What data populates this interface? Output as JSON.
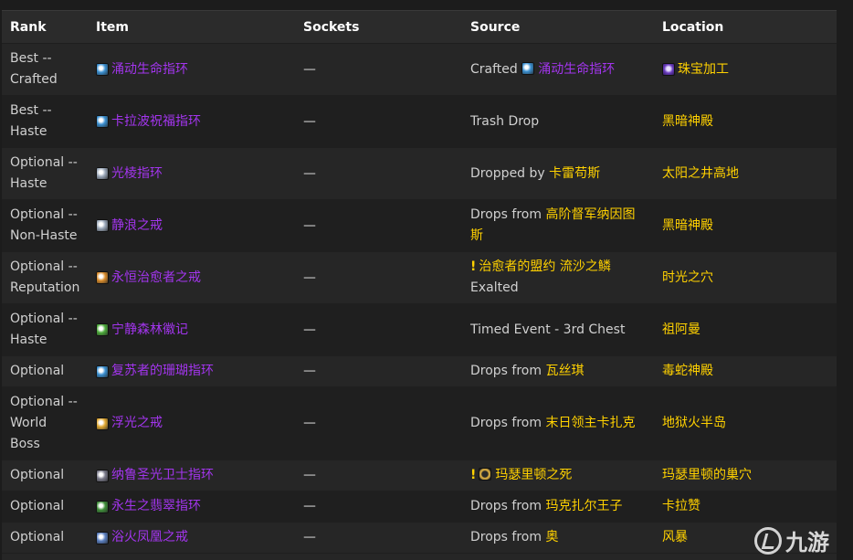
{
  "headers": {
    "rank": "Rank",
    "item": "Item",
    "sockets": "Sockets",
    "source": "Source",
    "location": "Location"
  },
  "rows": [
    {
      "rank": [
        "Best --",
        "Crafted"
      ],
      "icon": "blue-ring-icon",
      "icon_color": "#3a8fd0",
      "item": "涌动生命指环",
      "sockets": "—",
      "source_prefix": "Crafted",
      "source_icon": "blue-ring-icon",
      "source_link": "涌动生命指环",
      "source_link_color": "#a335ee",
      "source_suffix": "",
      "location_icon": "jewelcrafting-icon",
      "location": "珠宝加工",
      "excl": false
    },
    {
      "rank": [
        "Best --",
        "Haste"
      ],
      "icon": "blue-ring-icon",
      "icon_color": "#3a8fd0",
      "item": "卡拉波祝福指环",
      "sockets": "—",
      "source_prefix": "Trash Drop",
      "source_icon": "",
      "source_link": "",
      "source_link_color": "#ffd100",
      "source_suffix": "",
      "location_icon": "",
      "location": "黑暗神殿",
      "excl": false
    },
    {
      "rank": [
        "Optional --",
        "Haste"
      ],
      "icon": "silver-ring-icon",
      "icon_color": "#9aa7b8",
      "item": "光棱指环",
      "sockets": "—",
      "source_prefix": "Dropped by",
      "source_icon": "",
      "source_link": "卡雷苟斯",
      "source_link_color": "#ffd100",
      "source_suffix": "",
      "location_icon": "",
      "location": "太阳之井高地",
      "excl": false
    },
    {
      "rank": [
        "Optional --",
        "Non-Haste"
      ],
      "icon": "silver-ring-icon",
      "icon_color": "#9aa7b8",
      "item": "静浪之戒",
      "sockets": "—",
      "source_prefix": "Drops from",
      "source_icon": "",
      "source_link": "高阶督军纳因图",
      "source_link_color": "#ffd100",
      "source_suffix": "斯",
      "location_icon": "",
      "location": "黑暗神殿",
      "excl": false
    },
    {
      "rank": [
        "Optional --",
        "Reputation"
      ],
      "icon": "gold-ring-icon",
      "icon_color": "#d98c2b",
      "item": "永恒治愈者之戒",
      "sockets": "—",
      "source_prefix": "",
      "source_icon": "",
      "source_link": "治愈者的盟约 流沙之鳞",
      "source_link_color": "#ffd100",
      "source_suffix": "Exalted",
      "location_icon": "",
      "location": "时光之穴",
      "excl": true
    },
    {
      "rank": [
        "Optional --",
        "Haste"
      ],
      "icon": "green-ring-icon",
      "icon_color": "#4caa3a",
      "item": "宁静森林徽记",
      "sockets": "—",
      "source_prefix": "Timed Event - 3rd Chest",
      "source_icon": "",
      "source_link": "",
      "source_link_color": "#ffd100",
      "source_suffix": "",
      "location_icon": "",
      "location": "祖阿曼",
      "excl": false
    },
    {
      "rank": [
        "Optional"
      ],
      "icon": "blue-ring-icon",
      "icon_color": "#3a8fd0",
      "item": "复苏者的珊瑚指环",
      "sockets": "—",
      "source_prefix": "Drops from",
      "source_icon": "",
      "source_link": "瓦丝琪",
      "source_link_color": "#ffd100",
      "source_suffix": "",
      "location_icon": "",
      "location": "毒蛇神殿",
      "excl": false
    },
    {
      "rank": [
        "Optional --",
        "World",
        "Boss"
      ],
      "icon": "gold-ring-icon",
      "icon_color": "#e0a832",
      "item": "浮光之戒",
      "sockets": "—",
      "source_prefix": "Drops from",
      "source_icon": "",
      "source_link": "末日领主卡扎克",
      "source_link_color": "#ffd100",
      "source_suffix": "",
      "location_icon": "",
      "location": "地狱火半岛",
      "excl": false
    },
    {
      "rank": [
        "Optional"
      ],
      "icon": "dark-ring-icon",
      "icon_color": "#7a7a8a",
      "item": "纳鲁圣光卫士指环",
      "sockets": "—",
      "source_prefix": "",
      "source_icon": "achievement-icon",
      "source_link": "玛瑟里顿之死",
      "source_link_color": "#ffd100",
      "source_suffix": "",
      "location_icon": "",
      "location": "玛瑟里顿的巢穴",
      "excl": true
    },
    {
      "rank": [
        "Optional"
      ],
      "icon": "green-ring-icon",
      "icon_color": "#3f8f3a",
      "item": "永生之翡翠指环",
      "sockets": "—",
      "source_prefix": "Drops from",
      "source_icon": "",
      "source_link": "玛克扎尔王子",
      "source_link_color": "#ffd100",
      "source_suffix": "",
      "location_icon": "",
      "location": "卡拉赞",
      "excl": false
    },
    {
      "rank": [
        "Optional"
      ],
      "icon": "blue-ring-icon",
      "icon_color": "#5a7fc0",
      "item": "浴火凤凰之戒",
      "sockets": "—",
      "source_prefix": "Drops from",
      "source_icon": "",
      "source_link": "奥",
      "source_link_color": "#ffd100",
      "source_suffix": "",
      "location_icon": "",
      "location": "风暴",
      "excl": false
    }
  ],
  "watermark": "九游"
}
